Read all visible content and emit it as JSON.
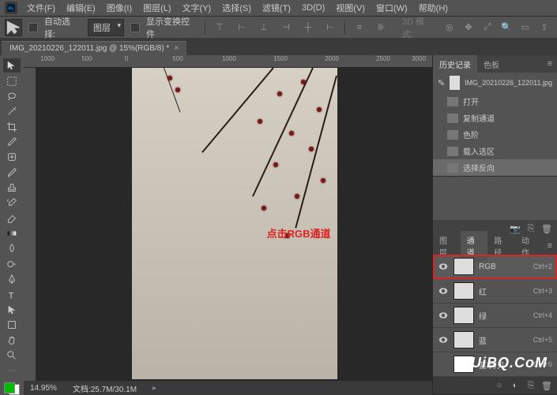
{
  "menu": {
    "items": [
      "文件(F)",
      "编辑(E)",
      "图像(I)",
      "图层(L)",
      "文字(Y)",
      "选择(S)",
      "滤镜(T)",
      "3D(D)",
      "视图(V)",
      "窗口(W)",
      "帮助(H)"
    ]
  },
  "options": {
    "auto_select_label": "自动选择:",
    "auto_select_target": "图层",
    "show_transform_label": "显示变换控件",
    "mode_label": "3D 模式:"
  },
  "tab": {
    "title": "IMG_20210226_122011.jpg @ 15%(RGB/8) *"
  },
  "ruler_ticks": [
    "1000",
    "500",
    "0",
    "500",
    "1000",
    "1500",
    "2000",
    "2500",
    "3000"
  ],
  "annotation": "点击RGB通道",
  "status": {
    "zoom": "14.95%",
    "docinfo": "文档:25.7M/30.1M"
  },
  "history_panel": {
    "tabs": [
      "历史记录",
      "色板"
    ],
    "source": "IMG_20210226_122011.jpg",
    "items": [
      {
        "label": "打开"
      },
      {
        "label": "复制通道"
      },
      {
        "label": "色阶"
      },
      {
        "label": "载入选区"
      },
      {
        "label": "选择反向",
        "active": true
      }
    ]
  },
  "channels_panel": {
    "tabs": [
      "图层",
      "通道",
      "路径",
      "动作"
    ],
    "active_tab": 1,
    "rows": [
      {
        "name": "RGB",
        "shortcut": "Ctrl+2",
        "visible": true,
        "highlighted": true
      },
      {
        "name": "红",
        "shortcut": "Ctrl+3",
        "visible": true
      },
      {
        "name": "绿",
        "shortcut": "Ctrl+4",
        "visible": true
      },
      {
        "name": "蓝",
        "shortcut": "Ctrl+5",
        "visible": true
      },
      {
        "name": "蓝 拷贝",
        "shortcut": "Ctrl+6",
        "visible": false
      }
    ]
  },
  "watermark": "UiBQ.CoM"
}
